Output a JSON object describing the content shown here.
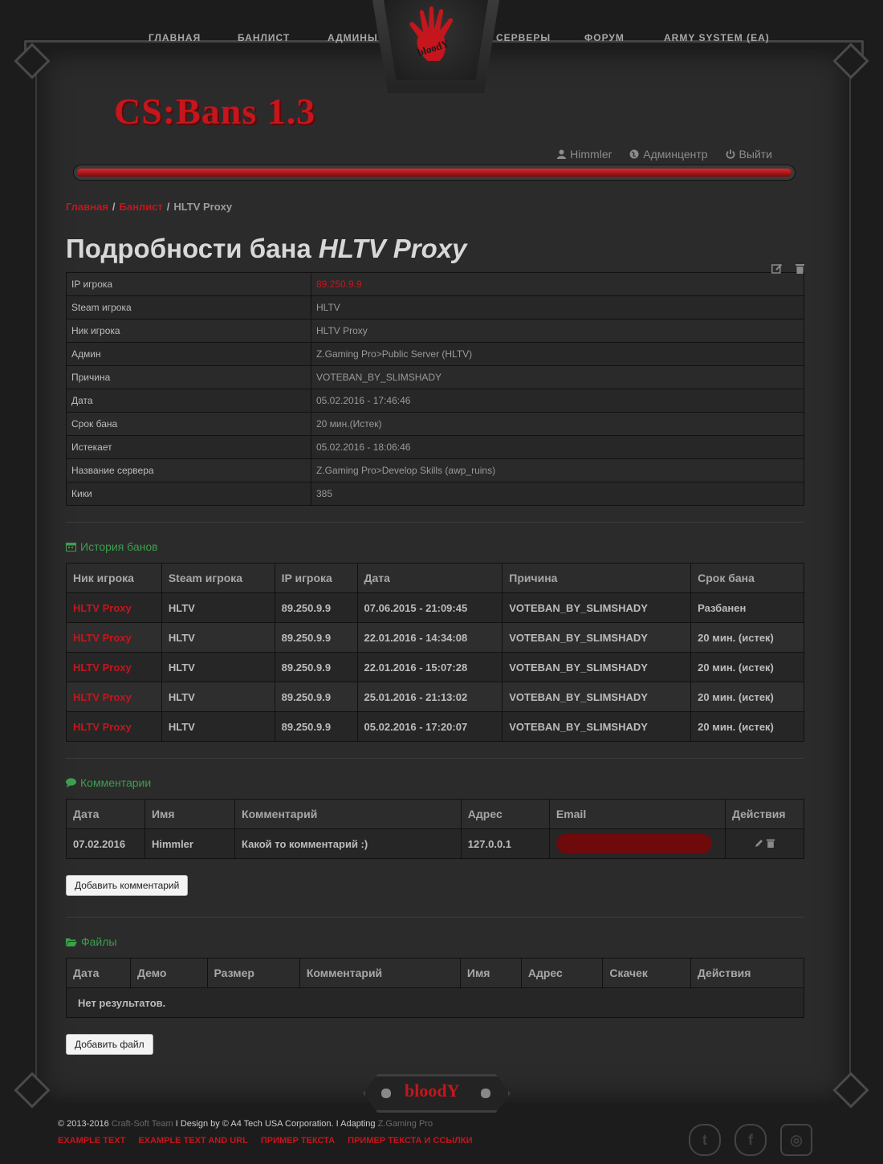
{
  "nav": {
    "items": [
      "ГЛАВНАЯ",
      "БАНЛИСТ",
      "АДМИНЫ",
      "СЕРВЕРЫ",
      "ФОРУМ",
      "ARMY SYSTEM (EA)"
    ],
    "logo_text": "bloodY"
  },
  "header": {
    "brand": "CS:Bans 1.3",
    "user": "Himmler",
    "admin_center": "Админцентр",
    "logout": "Выйти"
  },
  "breadcrumb": {
    "home": "Главная",
    "banlist": "Банлист",
    "current": "HLTV Proxy",
    "separator": "/"
  },
  "page": {
    "title_prefix": "Подробности бана",
    "title_name": "HLTV Proxy"
  },
  "details": [
    {
      "label": "IP игрока",
      "value": "89.250.9.9"
    },
    {
      "label": "Steam игрока",
      "value": "HLTV"
    },
    {
      "label": "Ник игрока",
      "value": "HLTV Proxy"
    },
    {
      "label": "Админ",
      "value": "Z.Gaming Pro>Public Server (HLTV)"
    },
    {
      "label": "Причина",
      "value": "VOTEBAN_BY_SLIMSHADY"
    },
    {
      "label": "Дата",
      "value": "05.02.2016 - 17:46:46"
    },
    {
      "label": "Срок бана",
      "value": "20 мин.(Истек)"
    },
    {
      "label": "Истекает",
      "value": "05.02.2016 - 18:06:46"
    },
    {
      "label": "Название сервера",
      "value": "Z.Gaming Pro>Develop Skills (awp_ruins)"
    },
    {
      "label": "Кики",
      "value": "385"
    }
  ],
  "history": {
    "title": "История банов",
    "headers": [
      "Ник игрока",
      "Steam игрока",
      "IP игрока",
      "Дата",
      "Причина",
      "Срок бана"
    ],
    "rows": [
      [
        "HLTV Proxy",
        "HLTV",
        "89.250.9.9",
        "07.06.2015 - 21:09:45",
        "VOTEBAN_BY_SLIMSHADY",
        "Разбанен"
      ],
      [
        "HLTV Proxy",
        "HLTV",
        "89.250.9.9",
        "22.01.2016 - 14:34:08",
        "VOTEBAN_BY_SLIMSHADY",
        "20 мин. (истек)"
      ],
      [
        "HLTV Proxy",
        "HLTV",
        "89.250.9.9",
        "22.01.2016 - 15:07:28",
        "VOTEBAN_BY_SLIMSHADY",
        "20 мин. (истек)"
      ],
      [
        "HLTV Proxy",
        "HLTV",
        "89.250.9.9",
        "25.01.2016 - 21:13:02",
        "VOTEBAN_BY_SLIMSHADY",
        "20 мин. (истек)"
      ],
      [
        "HLTV Proxy",
        "HLTV",
        "89.250.9.9",
        "05.02.2016 - 17:20:07",
        "VOTEBAN_BY_SLIMSHADY",
        "20 мин. (истек)"
      ]
    ]
  },
  "comments": {
    "title": "Комментарии",
    "headers": [
      "Дата",
      "Имя",
      "Комментарий",
      "Адрес",
      "Email",
      "Действия"
    ],
    "rows": [
      [
        "07.02.2016",
        "Himmler",
        "Какой то комментарий :)",
        "127.0.0.1"
      ]
    ],
    "add_button": "Добавить комментарий"
  },
  "files": {
    "title": "Файлы",
    "headers": [
      "Дата",
      "Демо",
      "Размер",
      "Комментарий",
      "Имя",
      "Адрес",
      "Скачек",
      "Действия"
    ],
    "empty": "Нет результатов.",
    "add_button": "Добавить файл"
  },
  "footer": {
    "copyright": "© 2013-2016",
    "team": "Craft-Soft Team",
    "design": "I Design by © A4 Tech USA Corporation. I Adapting",
    "adapter": "Z.Gaming Pro",
    "links": [
      "EXAMPLE TEXT",
      "EXAMPLE TEXT AND URL",
      "ПРИМЕР ТЕКСТА",
      "ПРИМЕР ТЕКСТА И ССЫЛКИ"
    ],
    "bottom_logo": "bloodY"
  },
  "colors": {
    "accent_red": "#c4161c",
    "section_green": "#3d9e4d",
    "background": "#2b2b2b"
  }
}
